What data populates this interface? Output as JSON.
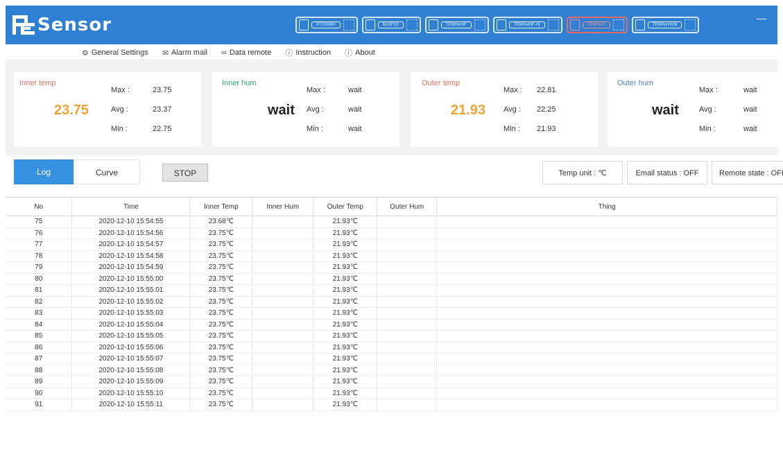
{
  "app": {
    "logo": "Sensor",
    "sensor_tabs": [
      {
        "label": "PT100/BH"
      },
      {
        "label": "BASFS3"
      },
      {
        "label": "TEMPerHF"
      },
      {
        "label": "TEMPerHF-HI"
      },
      {
        "label": "TEMPerX"
      },
      {
        "label": "TEMPerHUM"
      }
    ],
    "accent": "#2f7fd3"
  },
  "menu": {
    "general_settings": "General Settings",
    "alarm_mail": "Alarm mail",
    "data_remote": "Data remote",
    "instruction": "Instruction",
    "about": "About"
  },
  "stats": {
    "inner_temp": {
      "label": "Inner temp",
      "value": "23.75",
      "max_label": "Max :",
      "max": "23.75",
      "avg_label": "Avg :",
      "avg": "23.37",
      "min_label": "Min :",
      "min": "22.75"
    },
    "inner_hum": {
      "label": "Inner hum",
      "value": "wait",
      "max_label": "Max :",
      "max": "wait",
      "avg_label": "Avg :",
      "avg": "wait",
      "min_label": "Min :",
      "min": "wait"
    },
    "outer_temp": {
      "label": "Outer temp",
      "value": "21.93",
      "max_label": "Max :",
      "max": "22.81",
      "avg_label": "Avg :",
      "avg": "22.25",
      "min_label": "Min :",
      "min": "21.93"
    },
    "outer_hum": {
      "label": "Outer hum",
      "value": "wait",
      "max_label": "Max :",
      "max": "wait",
      "avg_label": "Avg :",
      "avg": "wait",
      "min_label": "Min :",
      "min": "wait"
    }
  },
  "controls": {
    "log_tab": "Log",
    "curve_tab": "Curve",
    "stop": "STOP",
    "temp_unit": "Temp unit : ℃",
    "email_status": "Email status : OFF",
    "remote_state": "Remote state : OFF"
  },
  "table": {
    "headers": [
      "No",
      "Time",
      "Inner Temp",
      "Inner Hum",
      "Outer Temp",
      "Outer Hum",
      "Thing"
    ],
    "rows": [
      [
        "75",
        "2020-12-10 15:54:55",
        "23.68℃",
        "",
        "21.93℃",
        "",
        ""
      ],
      [
        "76",
        "2020-12-10 15:54:56",
        "23.75℃",
        "",
        "21.93℃",
        "",
        ""
      ],
      [
        "77",
        "2020-12-10 15:54:57",
        "23.75℃",
        "",
        "21.93℃",
        "",
        ""
      ],
      [
        "78",
        "2020-12-10 15:54:58",
        "23.75℃",
        "",
        "21.93℃",
        "",
        ""
      ],
      [
        "79",
        "2020-12-10 15:54:59",
        "23.75℃",
        "",
        "21.93℃",
        "",
        ""
      ],
      [
        "80",
        "2020-12-10 15:55:00",
        "23.75℃",
        "",
        "21.93℃",
        "",
        ""
      ],
      [
        "81",
        "2020-12-10 15:55:01",
        "23.75℃",
        "",
        "21.93℃",
        "",
        ""
      ],
      [
        "82",
        "2020-12-10 15:55:02",
        "23.75℃",
        "",
        "21.93℃",
        "",
        ""
      ],
      [
        "83",
        "2020-12-10 15:55:03",
        "23.75℃",
        "",
        "21.93℃",
        "",
        ""
      ],
      [
        "84",
        "2020-12-10 15:55:04",
        "23.75℃",
        "",
        "21.93℃",
        "",
        ""
      ],
      [
        "85",
        "2020-12-10 15:55:05",
        "23.75℃",
        "",
        "21.93℃",
        "",
        ""
      ],
      [
        "86",
        "2020-12-10 15:55:06",
        "23.75℃",
        "",
        "21.93℃",
        "",
        ""
      ],
      [
        "87",
        "2020-12-10 15:55:07",
        "23.75℃",
        "",
        "21.93℃",
        "",
        ""
      ],
      [
        "88",
        "2020-12-10 15:55:08",
        "23.75℃",
        "",
        "21.93℃",
        "",
        ""
      ],
      [
        "89",
        "2020-12-10 15:55:09",
        "23.75℃",
        "",
        "21.93℃",
        "",
        ""
      ],
      [
        "90",
        "2020-12-10 15:55:10",
        "23.75℃",
        "",
        "21.93℃",
        "",
        ""
      ],
      [
        "91",
        "2020-12-10 15:55:11",
        "23.75℃",
        "",
        "21.93℃",
        "",
        ""
      ]
    ]
  }
}
